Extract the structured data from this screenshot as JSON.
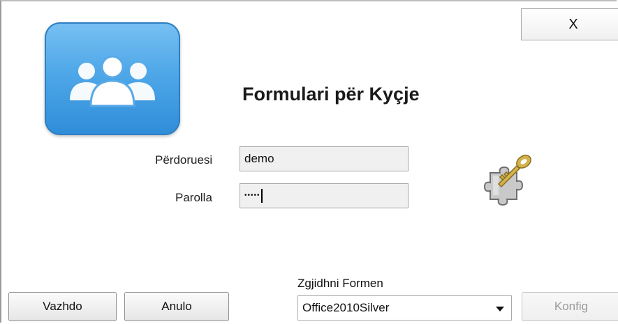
{
  "window": {
    "close_label": "X"
  },
  "icons": {
    "users": "users-group-icon",
    "login": "puzzle-key-icon",
    "dropdown": "chevron-down-icon"
  },
  "form": {
    "title": "Formulari për Kyçje",
    "username_label": "Përdoruesi",
    "username_value": "demo",
    "password_label": "Parolla",
    "password_value": "•••••"
  },
  "theme": {
    "label": "Zgjidhni Formen",
    "selected": "Office2010Silver"
  },
  "buttons": {
    "continue": "Vazhdo",
    "cancel": "Anulo",
    "config": "Konfig"
  },
  "colors": {
    "tile_top": "#78c0f2",
    "tile_bottom": "#2f8dd8",
    "key_gold": "#b89a3c"
  }
}
